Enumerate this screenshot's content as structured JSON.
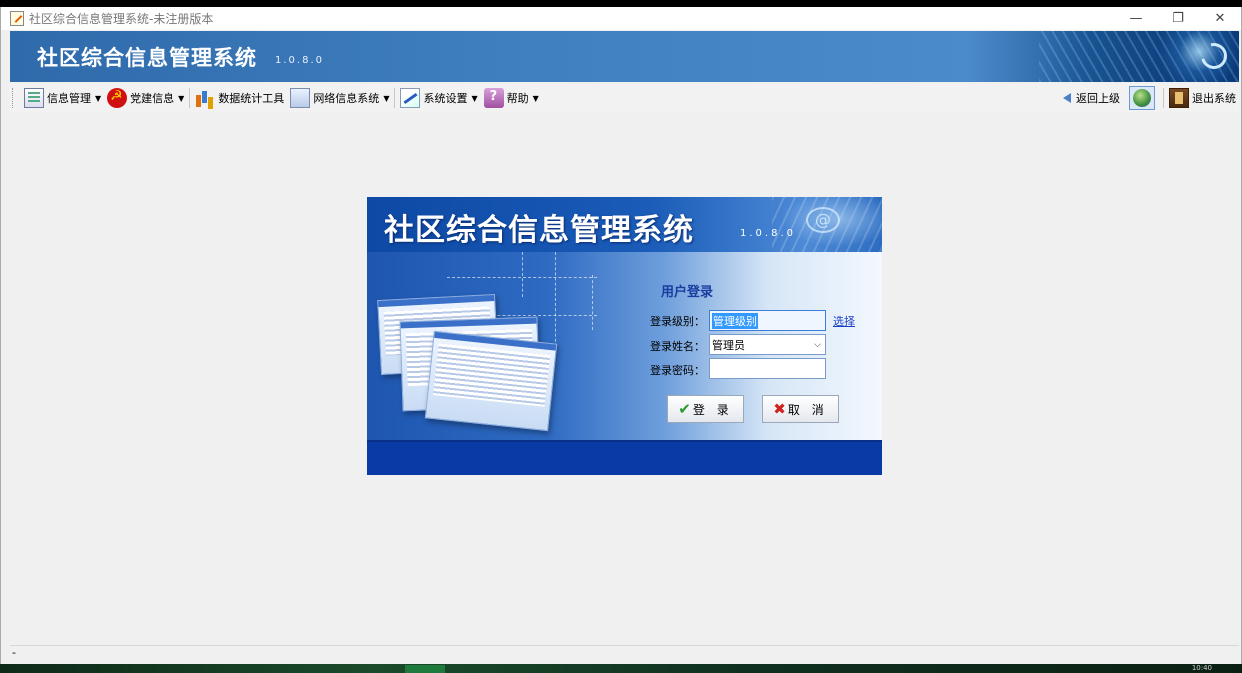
{
  "window": {
    "title": "社区综合信息管理系统-未注册版本",
    "controls": {
      "minimize": "—",
      "restore": "❐",
      "close": "✕"
    }
  },
  "banner": {
    "title": "社区综合信息管理系统",
    "version": "1.0.8.0"
  },
  "toolbar": {
    "items": [
      {
        "label": "信息管理",
        "icon": "info-manage-icon",
        "dropdown": true
      },
      {
        "label": "党建信息",
        "icon": "party-building-icon",
        "dropdown": true
      },
      {
        "label": "数据统计工具",
        "icon": "bar-chart-icon",
        "dropdown": false
      },
      {
        "label": "网络信息系统",
        "icon": "network-icon",
        "dropdown": true
      },
      {
        "label": "系统设置",
        "icon": "settings-pen-icon",
        "dropdown": true
      },
      {
        "label": "帮助",
        "icon": "help-book-icon",
        "dropdown": true
      }
    ],
    "back_label": "返回上级",
    "exit_label": "退出系统",
    "caret": "▼"
  },
  "login": {
    "title": "社区综合信息管理系统",
    "version": "1.0.8.0",
    "section_title": "用户登录",
    "level_label": "登录级别：",
    "level_value": "管理级别",
    "choose_link": "选择",
    "name_label": "登录姓名：",
    "name_value": "管理员",
    "password_label": "登录密码：",
    "password_value": "",
    "ok_label": "登 录",
    "cancel_label": "取 消",
    "ok_icon": "✔",
    "cancel_icon": "✖",
    "at_symbol": "@"
  },
  "statusbar": {
    "text": "-"
  },
  "taskbar": {
    "clock": "10:40"
  }
}
